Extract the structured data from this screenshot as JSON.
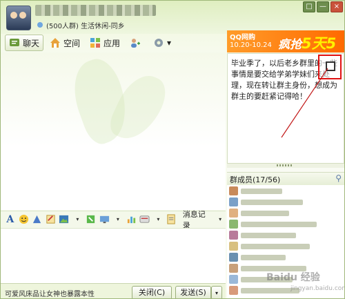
{
  "header": {
    "subtitle": "(500人群) 生活休闲-同乡"
  },
  "window_controls": [
    "□",
    "—",
    "×"
  ],
  "ad": {
    "top": "QQ网购",
    "date": "10.20-10.24",
    "big_prefix": "疯抢",
    "big_num1": "5天",
    "big_num2": "5夜"
  },
  "toolbar": {
    "chat": "聊天",
    "space": "空间",
    "apps": "应用"
  },
  "format_bar": {
    "history": "消息记录"
  },
  "bottom": {
    "tip": "可爱风床品让女神也暴露本性",
    "close": "关闭(C)",
    "send": "发送(S)"
  },
  "notice": {
    "text": "毕业季了，以后老乡群里的一些事情是要交给学弟学妹们来处理，现在转让群主身份，想成为群主的要赶紧记得哈！"
  },
  "members": {
    "title": "群成员(17/56)"
  },
  "watermark": {
    "text": "Baidu 经验",
    "url": "jingyan.baidu.com"
  },
  "colors": {
    "accent_green": "#9fb77a",
    "ad_orange": "#ff6a00",
    "highlight_red": "#e01010"
  }
}
